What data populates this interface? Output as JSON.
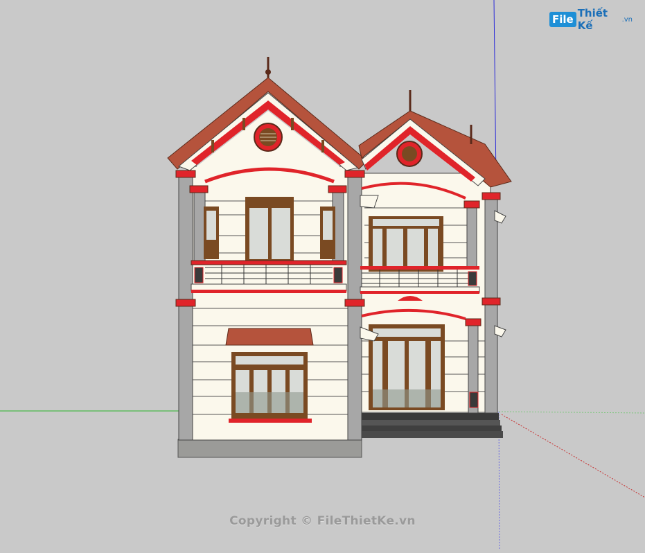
{
  "watermark": {
    "logo_file": "File",
    "logo_rest": "Thiết Kế",
    "logo_ext": ".vn",
    "copyright": "Copyright © FileThietKe.vn"
  },
  "colors": {
    "background": "#c9c9c9",
    "wall": "#fbf8ec",
    "roof_tile": "#b5533c",
    "trim_red": "#e0242a",
    "column_gray": "#a7a7a7",
    "wood_frame": "#7a4a22",
    "glass": "#d9dcd8",
    "axis_green": "#2bb52b",
    "axis_blue": "#2a2ad8",
    "axis_red": "#c83030"
  },
  "icons": {
    "logo": "filethietke-logo-icon"
  }
}
